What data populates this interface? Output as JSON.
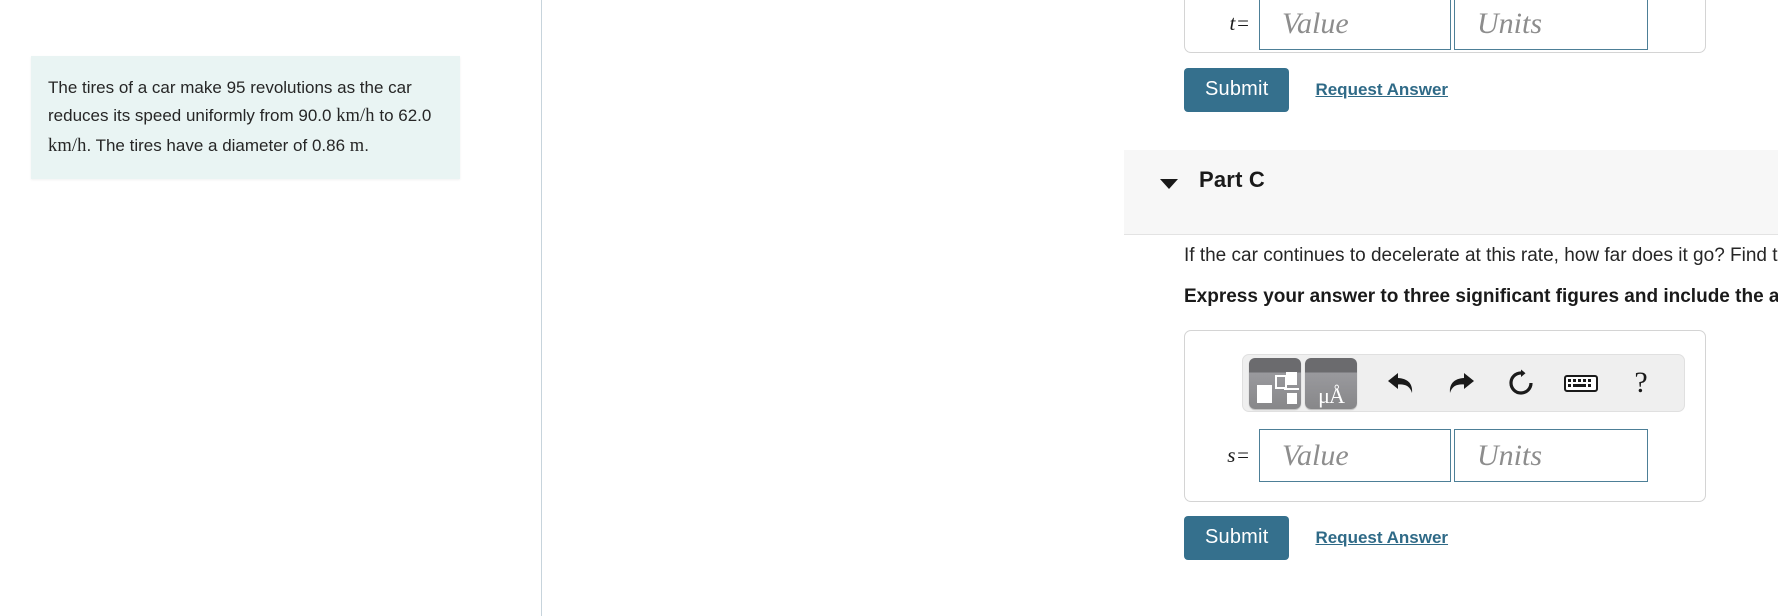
{
  "problem": {
    "segments": [
      {
        "t": "The tires of a car make 95 revolutions as the car reduces its speed uniformly from 90.0 ",
        "math": false
      },
      {
        "t": "km/h",
        "math": true
      },
      {
        "t": " to 62.0 ",
        "math": false
      },
      {
        "t": "km/h",
        "math": true
      },
      {
        "t": ". The tires have a diameter of 0.86 ",
        "math": false
      },
      {
        "t": "m",
        "math": true
      },
      {
        "t": ".",
        "math": false
      }
    ],
    "full_text": "The tires of a car make 95 revolutions as the car reduces its speed uniformly from 90.0 km/h to 62.0 km/h. The tires have a diameter of 0.86 m."
  },
  "part_b": {
    "variable_label": "t",
    "equals": "=",
    "value_placeholder": "Value",
    "units_placeholder": "Units",
    "value_current": "",
    "units_current": "",
    "submit_label": "Submit",
    "request_answer_label": "Request Answer"
  },
  "part_c": {
    "title": "Part C",
    "toggle_icon": "caret-down-icon",
    "question": "If the car continues to decelerate at this rate, how far does it go? Find the total distance.",
    "instruction": "Express your answer to three significant figures and include the appropriate units.",
    "variable_label": "s",
    "equals": "=",
    "value_placeholder": "Value",
    "units_placeholder": "Units",
    "value_current": "",
    "units_current": "",
    "submit_label": "Submit",
    "request_answer_label": "Request Answer",
    "toolbar": {
      "templates_button": "math-templates-icon",
      "units_button": "units-palette-icon",
      "units_button_glyph": "μÅ",
      "undo_button": "undo-icon",
      "redo_button": "redo-icon",
      "reset_button": "reset-icon",
      "keyboard_button": "keyboard-icon",
      "help_button": "?"
    }
  },
  "colors": {
    "accent_button": "#35708d",
    "link": "#2f6a87",
    "problem_card_bg": "#e9f4f3",
    "header_band_bg": "#f7f7f7",
    "field_border": "#4d7f97",
    "toolbar_bg": "#efefef"
  }
}
